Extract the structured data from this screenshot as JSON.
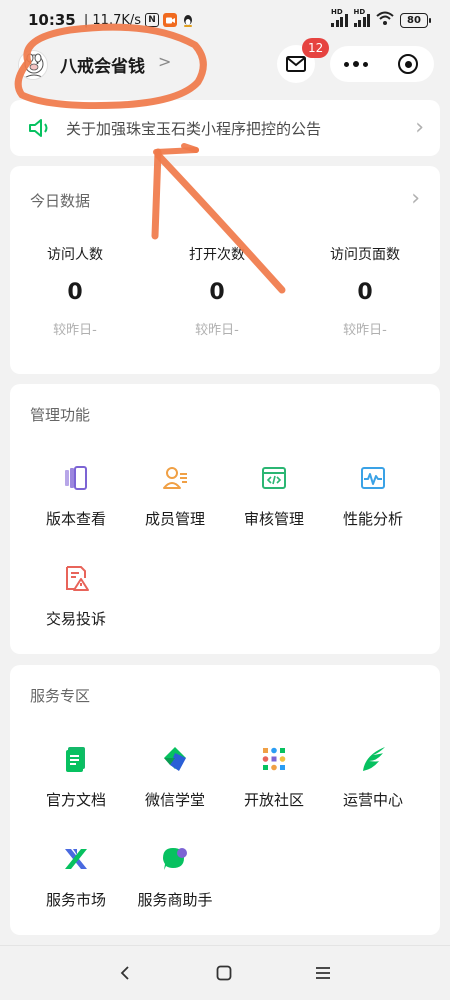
{
  "status_bar": {
    "time": "10:35",
    "speed": "11.7K/s",
    "n_icon": "N",
    "qq_icon": "penguin",
    "battery": "80"
  },
  "header": {
    "app_name": "八戒会省钱",
    "chevron": ">",
    "mail_badge": "12"
  },
  "notice": {
    "text": "关于加强珠宝玉石类小程序把控的公告"
  },
  "today": {
    "title": "今日数据",
    "stats": [
      {
        "label": "访问人数",
        "value": "0",
        "compare": "较昨日-"
      },
      {
        "label": "打开次数",
        "value": "0",
        "compare": "较昨日-"
      },
      {
        "label": "访问页面数",
        "value": "0",
        "compare": "较昨日-"
      }
    ]
  },
  "manage": {
    "title": "管理功能",
    "items": [
      {
        "label": "版本查看",
        "icon": "version-icon"
      },
      {
        "label": "成员管理",
        "icon": "member-icon"
      },
      {
        "label": "审核管理",
        "icon": "review-code-icon"
      },
      {
        "label": "性能分析",
        "icon": "performance-icon"
      },
      {
        "label": "交易投诉",
        "icon": "complaint-icon"
      }
    ]
  },
  "service": {
    "title": "服务专区",
    "items": [
      {
        "label": "官方文档",
        "icon": "document-icon"
      },
      {
        "label": "微信学堂",
        "icon": "academy-icon"
      },
      {
        "label": "开放社区",
        "icon": "community-icon"
      },
      {
        "label": "运营中心",
        "icon": "operations-icon"
      },
      {
        "label": "服务市场",
        "icon": "market-icon"
      },
      {
        "label": "服务商助手",
        "icon": "provider-assistant-icon"
      }
    ]
  },
  "colors": {
    "accent_green": "#07c160",
    "badge_red": "#e64340",
    "annotation_orange": "#f07a4a"
  }
}
